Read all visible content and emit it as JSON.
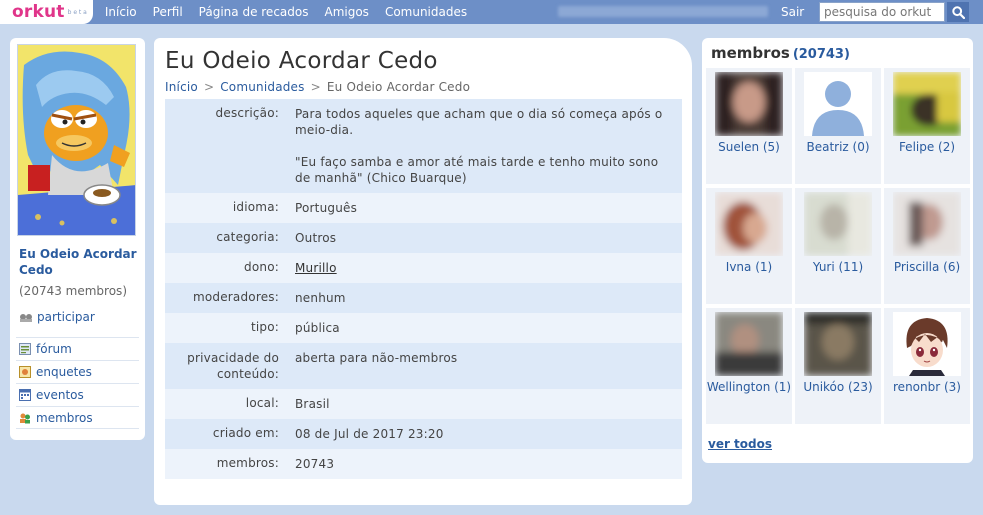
{
  "header": {
    "logo": "orkut",
    "logo_beta": "b e t a",
    "nav": [
      "Início",
      "Perfil",
      "Página de recados",
      "Amigos",
      "Comunidades"
    ],
    "logout": "Sair",
    "search_placeholder": "pesquisa do orkut"
  },
  "sidebar": {
    "community_name": "Eu Odeio Acordar Cedo",
    "member_count": "(20743 membros)",
    "participate": "participar",
    "menu": [
      "fórum",
      "enquetes",
      "eventos",
      "membros"
    ]
  },
  "main": {
    "title": "Eu Odeio Acordar Cedo",
    "breadcrumb": [
      "Início",
      "Comunidades",
      "Eu Odeio Acordar Cedo"
    ],
    "breadcrumb_sep": ">",
    "fields": {
      "descricao_label": "descrição:",
      "descricao_line1": "Para todos aqueles que acham que o dia só começa após o meio-dia.",
      "descricao_line2": "\"Eu faço samba e amor até mais tarde e tenho muito sono de manhã\" (Chico Buarque)",
      "idioma_label": "idioma:",
      "idioma": "Português",
      "categoria_label": "categoria:",
      "categoria": "Outros",
      "dono_label": "dono:",
      "dono": "Murillo",
      "moderadores_label": "moderadores:",
      "moderadores": "nenhum",
      "tipo_label": "tipo:",
      "tipo": "pública",
      "privacidade_label": "privacidade do conteúdo:",
      "privacidade": "aberta para não-membros",
      "local_label": "local:",
      "local": "Brasil",
      "criado_label": "criado em:",
      "criado": "08 de Jul de 2017 23:20",
      "membros_label": "membros:",
      "membros": "20743"
    }
  },
  "members": {
    "title": "membros",
    "count": "(20743)",
    "list": [
      {
        "name": "Suelen (5)",
        "photo": "blurred-photo"
      },
      {
        "name": "Beatriz (0)",
        "photo": "default-avatar-icon"
      },
      {
        "name": "Felipe (2)",
        "photo": "blurred-photo"
      },
      {
        "name": "Ivna (1)",
        "photo": "blurred-photo"
      },
      {
        "name": "Yuri (11)",
        "photo": "blurred-photo"
      },
      {
        "name": "Priscilla (6)",
        "photo": "blurred-photo"
      },
      {
        "name": "Wellington (1)",
        "photo": "blurred-photo"
      },
      {
        "name": "Unikóo (23)",
        "photo": "blurred-photo"
      },
      {
        "name": "renonbr (3)",
        "photo": "anime-avatar"
      }
    ],
    "see_all": "ver todos"
  },
  "colors": {
    "page_bg": "#c9d9ee",
    "topbar": "#6d8fc7",
    "logo_pink": "#e0358a",
    "link_blue": "#2a5b9e",
    "row_dark": "#dde9f8",
    "row_light": "#edf3fb"
  }
}
